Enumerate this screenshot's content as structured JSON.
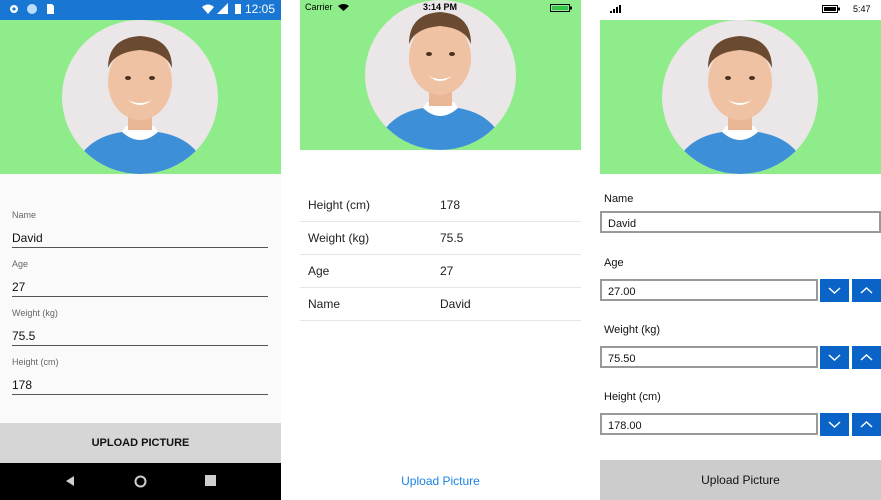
{
  "android": {
    "status_time": "12:05",
    "fields": [
      {
        "label": "Name",
        "value": "David"
      },
      {
        "label": "Age",
        "value": "27"
      },
      {
        "label": "Weight (kg)",
        "value": "75.5"
      },
      {
        "label": "Height (cm)",
        "value": "178"
      }
    ],
    "upload_label": "UPLOAD PICTURE",
    "colors": {
      "status_bar": "#1976d2",
      "hero": "#8fec8b",
      "button": "#d6d6d6"
    }
  },
  "ios": {
    "carrier": "Carrier",
    "status_time": "3:14 PM",
    "rows": [
      {
        "key": "Height (cm)",
        "value": "178"
      },
      {
        "key": "Weight (kg)",
        "value": "75.5"
      },
      {
        "key": "Age",
        "value": "27"
      },
      {
        "key": "Name",
        "value": "David"
      }
    ],
    "upload_label": "Upload Picture",
    "colors": {
      "link": "#1a82e2"
    }
  },
  "uwp": {
    "status_time": "5:47",
    "name": {
      "label": "Name",
      "value": "David"
    },
    "age": {
      "label": "Age",
      "value": "27.00"
    },
    "weight": {
      "label": "Weight (kg)",
      "value": "75.50"
    },
    "height": {
      "label": "Height (cm)",
      "value": "178.00"
    },
    "upload_label": "Upload Picture",
    "colors": {
      "spin": "#0a63c6",
      "button": "#cccccc"
    }
  }
}
